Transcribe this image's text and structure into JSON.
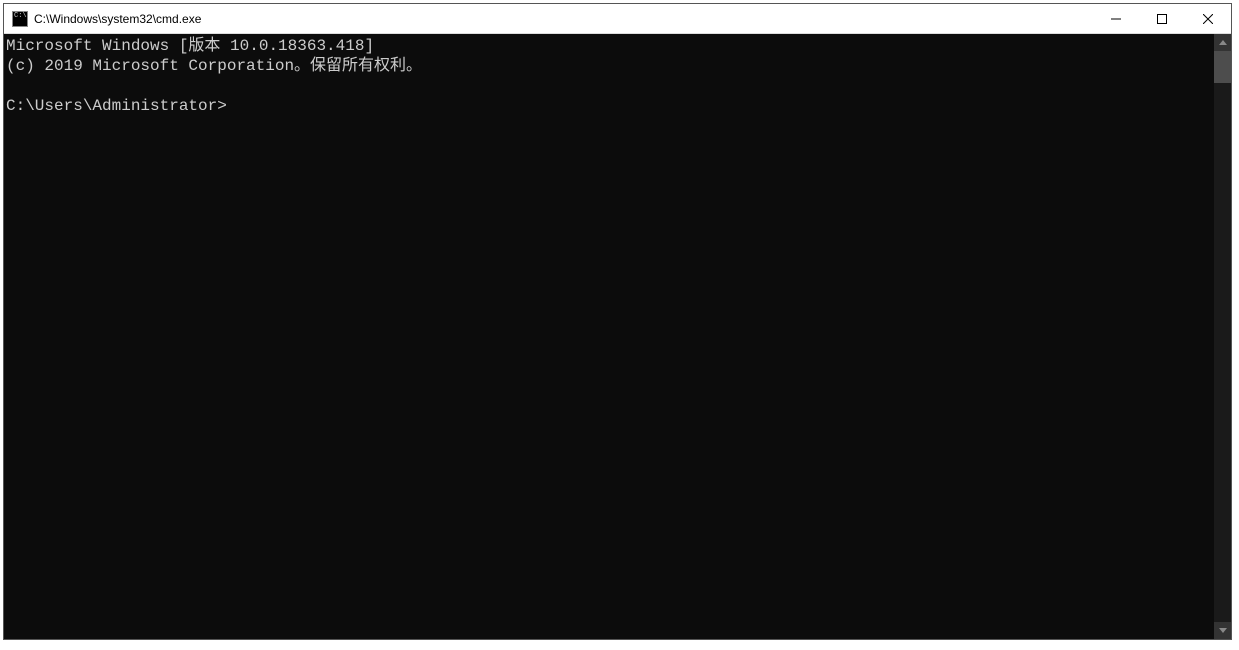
{
  "titlebar": {
    "title": "C:\\Windows\\system32\\cmd.exe"
  },
  "terminal": {
    "line1": "Microsoft Windows [版本 10.0.18363.418]",
    "line2": "(c) 2019 Microsoft Corporation。保留所有权利。",
    "blank": "",
    "prompt": "C:\\Users\\Administrator>"
  }
}
